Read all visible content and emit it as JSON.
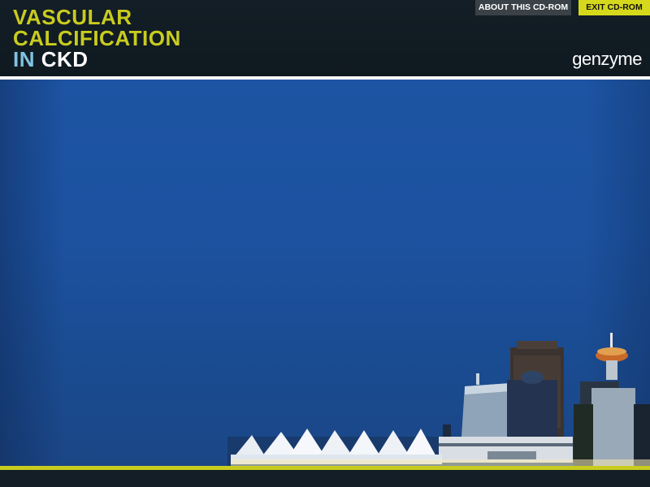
{
  "header": {
    "title_line1": "VASCULAR",
    "title_line2": "CALCIFICATION",
    "title_in": "IN",
    "title_ckd": "CKD",
    "logo_text": "genzyme"
  },
  "nav": {
    "about_label": "ABOUT THIS CD-ROM",
    "exit_label": "EXIT CD-ROM"
  },
  "colors": {
    "accent_yellow": "#c8cc1e",
    "accent_cyan": "#7fc3e0",
    "header_bg": "#141e26",
    "sky_blue": "#1d54a3"
  },
  "icons": [
    "genzyme-logo",
    "city-skyline-image"
  ]
}
